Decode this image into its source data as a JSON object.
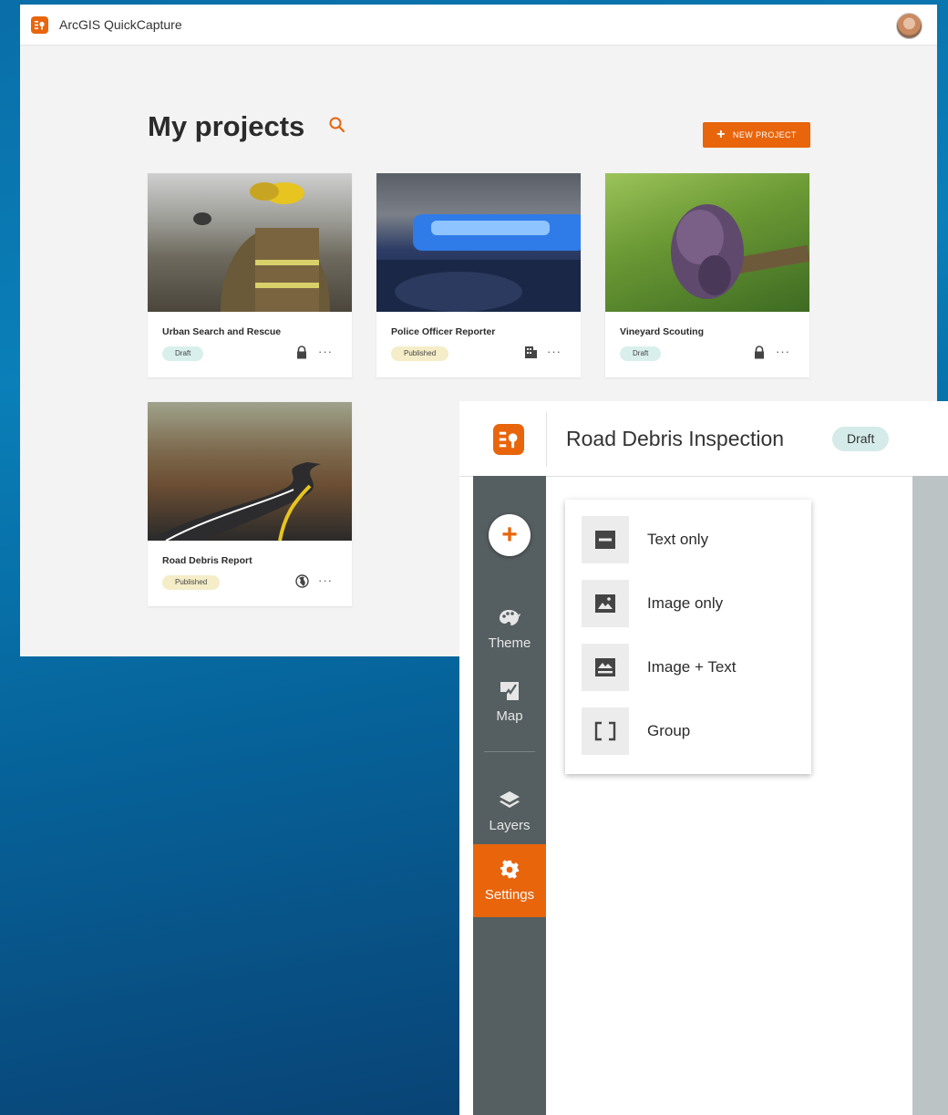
{
  "app": {
    "title": "ArcGIS QuickCapture"
  },
  "projects": {
    "heading": "My projects",
    "new_button": "NEW PROJECT",
    "cards": [
      {
        "name": "Urban Search and Rescue",
        "status": "Draft",
        "access": "lock-icon",
        "more": "···"
      },
      {
        "name": "Police Officer Reporter",
        "status": "Published",
        "access": "organization-icon",
        "more": "···"
      },
      {
        "name": "Vineyard Scouting",
        "status": "Draft",
        "access": "lock-icon",
        "more": "···"
      },
      {
        "name": "Road Debris Report",
        "status": "Published",
        "access": "globe-icon",
        "more": "···"
      }
    ]
  },
  "editor": {
    "title": "Road Debris Inspection",
    "status": "Draft",
    "add_label": "+",
    "nav": [
      {
        "label": "Theme",
        "icon": "palette-icon"
      },
      {
        "label": "Map",
        "icon": "map-icon"
      },
      {
        "label": "Layers",
        "icon": "layers-icon"
      },
      {
        "label": "Settings",
        "icon": "gear-icon",
        "active": true
      }
    ],
    "menu": [
      {
        "label": "Text only",
        "icon": "text-only-icon"
      },
      {
        "label": "Image only",
        "icon": "image-only-icon"
      },
      {
        "label": "Image + Text",
        "icon": "image-text-icon"
      },
      {
        "label": "Group",
        "icon": "group-icon"
      }
    ]
  },
  "colors": {
    "accent": "#e8650c",
    "draft_badge": "#d9efec",
    "published_badge": "#f5edc8",
    "sidebar": "#555e60"
  }
}
